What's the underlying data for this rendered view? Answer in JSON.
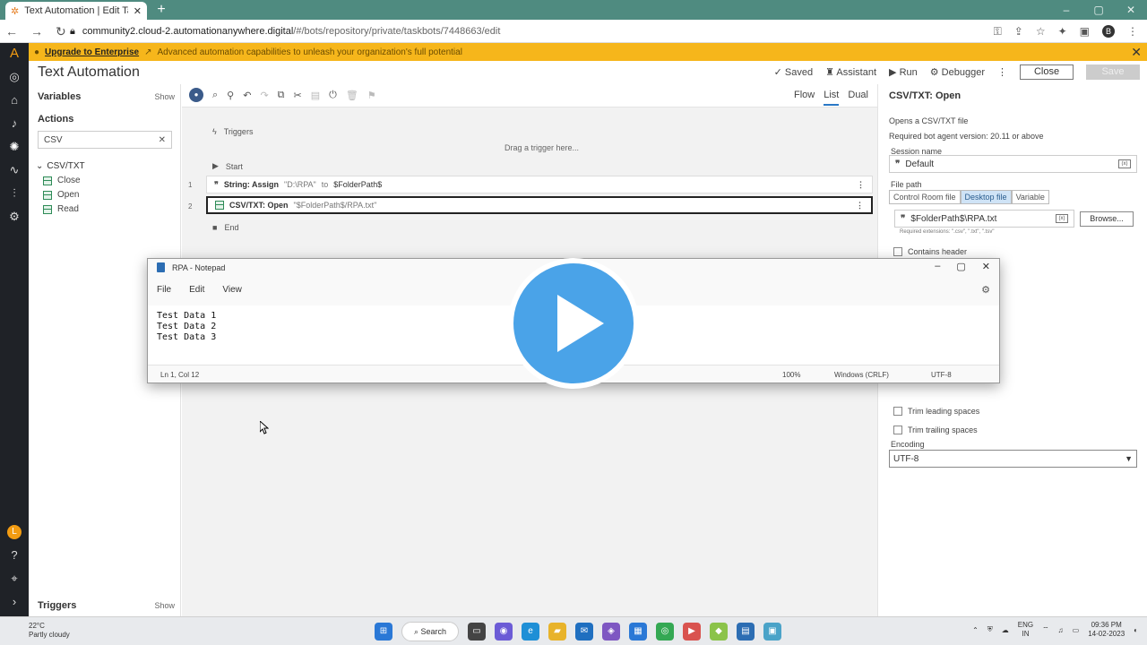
{
  "browser": {
    "tab_title": "Text Automation | Edit Task Bot |",
    "url_host": "community2.cloud-2.automationanywhere.digital",
    "url_path": "/#/bots/repository/private/taskbots/7448663/edit",
    "profile_initial": "B"
  },
  "banner": {
    "link": "Upgrade to Enterprise",
    "text": "Advanced automation capabilities to unleash your organization's full potential"
  },
  "header": {
    "title": "Text Automation",
    "saved": "Saved",
    "assistant": "Assistant",
    "run": "Run",
    "debugger": "Debugger",
    "close": "Close",
    "save": "Save"
  },
  "left": {
    "variables": "Variables",
    "show": "Show",
    "actions": "Actions",
    "search_value": "CSV",
    "group": "CSV/TXT",
    "items": [
      "Close",
      "Open",
      "Read"
    ],
    "triggers": "Triggers"
  },
  "toolbar": {
    "views": [
      "Flow",
      "List",
      "Dual"
    ]
  },
  "canvas": {
    "triggers": "Triggers",
    "drag_hint": "Drag a trigger here...",
    "start": "Start",
    "end": "End",
    "lines": [
      {
        "num": "1",
        "label": "String: Assign",
        "literal": "\"D:\\RPA\"",
        "mid": "to",
        "target": "$FolderPath$"
      },
      {
        "num": "2",
        "label": "CSV/TXT: Open",
        "literal": "\"$FolderPath$/RPA.txt\"",
        "mid": "",
        "target": ""
      }
    ]
  },
  "props": {
    "title": "CSV/TXT: Open",
    "desc": "Opens a CSV/TXT file",
    "version": "Required bot agent version: 20.11 or above",
    "session_label": "Session name",
    "session_value": "Default",
    "file_path_label": "File path",
    "source_options": [
      "Control Room file",
      "Desktop file",
      "Variable"
    ],
    "file_value": "$FolderPath$\\RPA.txt",
    "browse": "Browse...",
    "extensions": "Required extensions: \".csv\", \".txt\", \".tsv\"",
    "contains_header": "Contains header",
    "trim_leading": "Trim leading spaces",
    "trim_trailing": "Trim trailing spaces",
    "encoding_label": "Encoding",
    "encoding_value": "UTF-8"
  },
  "notepad": {
    "title": "RPA - Notepad",
    "menu": [
      "File",
      "Edit",
      "View"
    ],
    "lines": [
      "Test Data 1",
      "Test Data 2",
      "Test Data 3"
    ],
    "status_pos": "Ln 1, Col 12",
    "status_zoom": "100%",
    "status_eol": "Windows (CRLF)",
    "status_enc": "UTF-8"
  },
  "taskbar": {
    "temp": "22°C",
    "weather": "Partly cloudy",
    "search": "Search",
    "lang_top": "ENG",
    "lang_bottom": "IN",
    "time": "09:36 PM",
    "date": "14-02-2023"
  },
  "rail": {
    "avatar": "L"
  },
  "colors": {
    "tabstrip": "#4f8b80",
    "banner": "#f6b61b",
    "rail": "#1f2227",
    "play": "#4aa3e8"
  }
}
